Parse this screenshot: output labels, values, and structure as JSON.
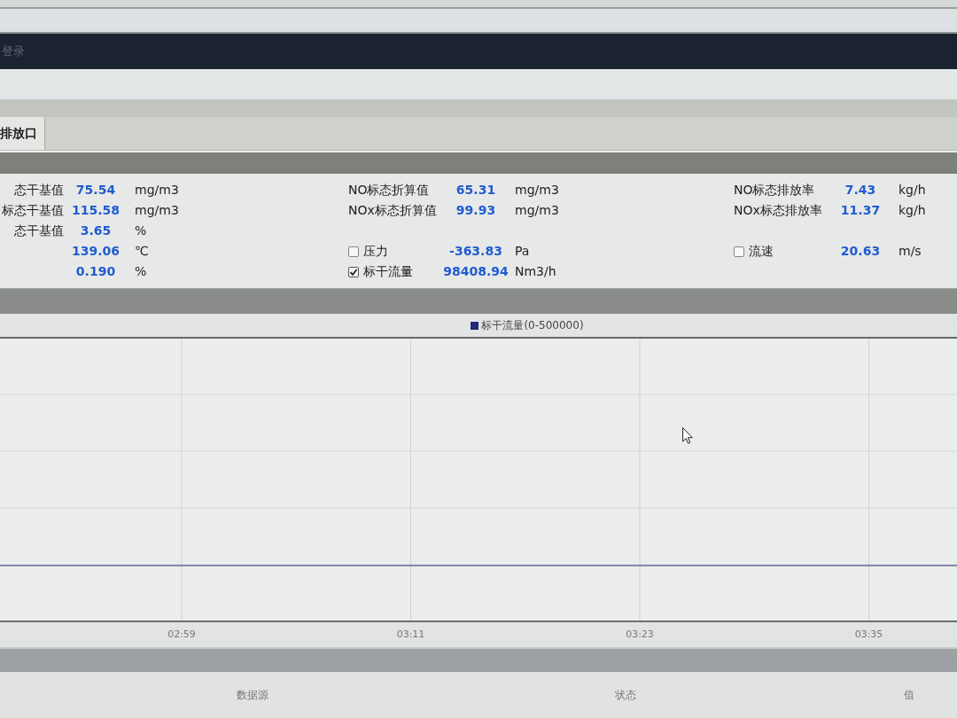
{
  "header": {
    "title": "登录"
  },
  "tabs": [
    {
      "label": "排放口",
      "selected": true
    }
  ],
  "data_panel": {
    "columns": [
      {
        "groups": [
          {
            "items": [
              {
                "kind": "reading",
                "label": "态干基值",
                "value": "75.54",
                "unit": "mg/m3"
              },
              {
                "kind": "reading",
                "label": "标态干基值",
                "value": "115.58",
                "unit": "mg/m3"
              },
              {
                "kind": "reading",
                "label": "态干基值",
                "value": "3.65",
                "unit": "%"
              },
              {
                "kind": "reading",
                "value": "139.06",
                "unit": "℃"
              },
              {
                "kind": "reading",
                "value": "0.190",
                "unit": "%"
              }
            ]
          }
        ]
      },
      {
        "groups": [
          {
            "items": [
              {
                "kind": "reading",
                "label": "NO标态折算值",
                "value": "65.31",
                "unit": "mg/m3"
              },
              {
                "kind": "reading",
                "label": "NOx标态折算值",
                "value": "99.93",
                "unit": "mg/m3"
              }
            ]
          },
          {
            "items": [
              {
                "kind": "checkbox",
                "label": "压力",
                "checked": false,
                "value": "-363.83",
                "unit": "Pa"
              },
              {
                "kind": "checkbox",
                "label": "标干流量",
                "checked": true,
                "value": "98408.94",
                "unit": "Nm3/h"
              }
            ]
          }
        ]
      },
      {
        "groups": [
          {
            "items": [
              {
                "kind": "reading",
                "label": "NO标态排放率",
                "value": "7.43",
                "unit": "kg/h"
              },
              {
                "kind": "reading",
                "label": "NOx标态排放率",
                "value": "11.37",
                "unit": "kg/h"
              }
            ]
          },
          {
            "items": [
              {
                "kind": "checkbox",
                "label": "流速",
                "checked": false,
                "value": "20.63",
                "unit": "m/s"
              }
            ]
          }
        ]
      }
    ]
  },
  "trend_chart": {
    "legend": [
      {
        "label": "标干流量(0-500000)",
        "color": "#1f2a78"
      }
    ],
    "time_labels": [
      "02:59",
      "03:11",
      "03:23",
      "03:35"
    ]
  },
  "table": {
    "columns": [
      "数据源",
      "状态",
      "值"
    ]
  }
}
